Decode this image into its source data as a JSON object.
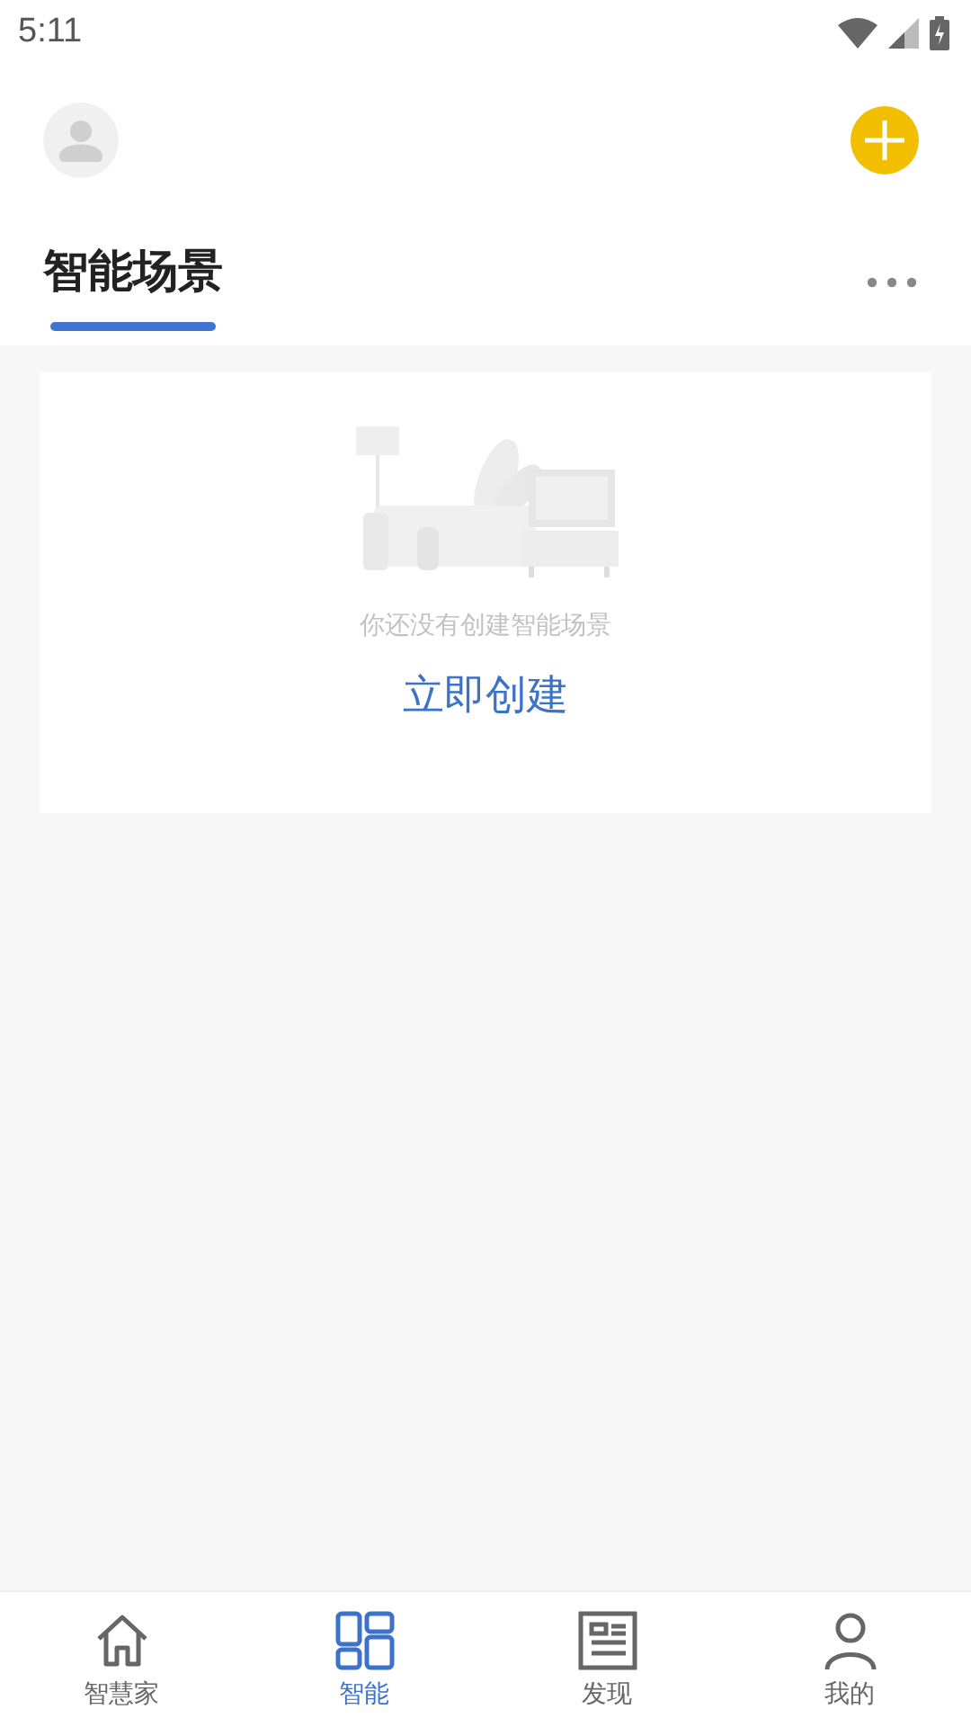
{
  "status_bar": {
    "time": "5:11"
  },
  "header": {
    "tabs": [
      {
        "label": "智能场景",
        "selected": true
      }
    ]
  },
  "empty_state": {
    "message": "你还没有创建智能场景",
    "action": "立即创建"
  },
  "bottom_nav": [
    {
      "kind": "home",
      "label": "智慧家",
      "selected": false
    },
    {
      "kind": "grid",
      "label": "智能",
      "selected": true
    },
    {
      "kind": "news",
      "label": "发现",
      "selected": false
    },
    {
      "kind": "person",
      "label": "我的",
      "selected": false
    }
  ]
}
